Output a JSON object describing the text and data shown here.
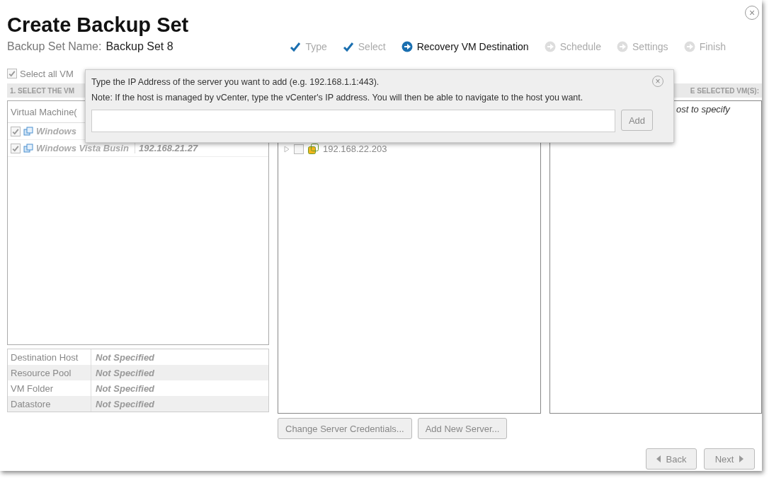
{
  "window": {
    "title": "Create Backup Set",
    "close": "×"
  },
  "backup_set_name": {
    "label": "Backup Set Name:",
    "value": "Backup Set 8"
  },
  "steps": [
    {
      "label": "Type",
      "done": true,
      "current": false
    },
    {
      "label": "Select",
      "done": true,
      "current": false
    },
    {
      "label": "Recovery VM Destination",
      "done": false,
      "current": true
    },
    {
      "label": "Schedule",
      "done": false,
      "current": false
    },
    {
      "label": "Settings",
      "done": false,
      "current": false
    },
    {
      "label": "Finish",
      "done": false,
      "current": false
    }
  ],
  "select_all": {
    "label": "Select all VM",
    "checked": true
  },
  "left_panel": {
    "header": "1. SELECT THE VM",
    "list_header": "Virtual Machine(",
    "rows": [
      {
        "name": "Windows ",
        "checked": true
      },
      {
        "name": "Windows Vista Busin",
        "ip": "192.168.21.27",
        "checked": true
      }
    ],
    "properties": [
      {
        "label": "Destination Host",
        "value": "Not Specified"
      },
      {
        "label": "Resource Pool",
        "value": "Not Specified"
      },
      {
        "label": "VM Folder",
        "value": "Not Specified"
      },
      {
        "label": "Datastore",
        "value": "Not Specified"
      }
    ]
  },
  "middle_panel": {
    "tree": [
      {
        "label": "192.168.22.203",
        "expanded": false,
        "checked": false
      }
    ],
    "buttons": [
      "Change Server Credentials...",
      "Add New Server..."
    ]
  },
  "right_panel": {
    "header": "E SELECTED VM(S):",
    "hint": "ost to specify"
  },
  "add_server_popup": {
    "line1": "Type the IP Address of the server you want to add (e.g. 192.168.1.1:443).",
    "line2": "Note: If the host is managed by vCenter, type the vCenter's IP address. You will then be able to navigate to the host you want.",
    "button": "Add",
    "close": "×"
  },
  "nav": {
    "back": "Back",
    "next": "Next"
  }
}
